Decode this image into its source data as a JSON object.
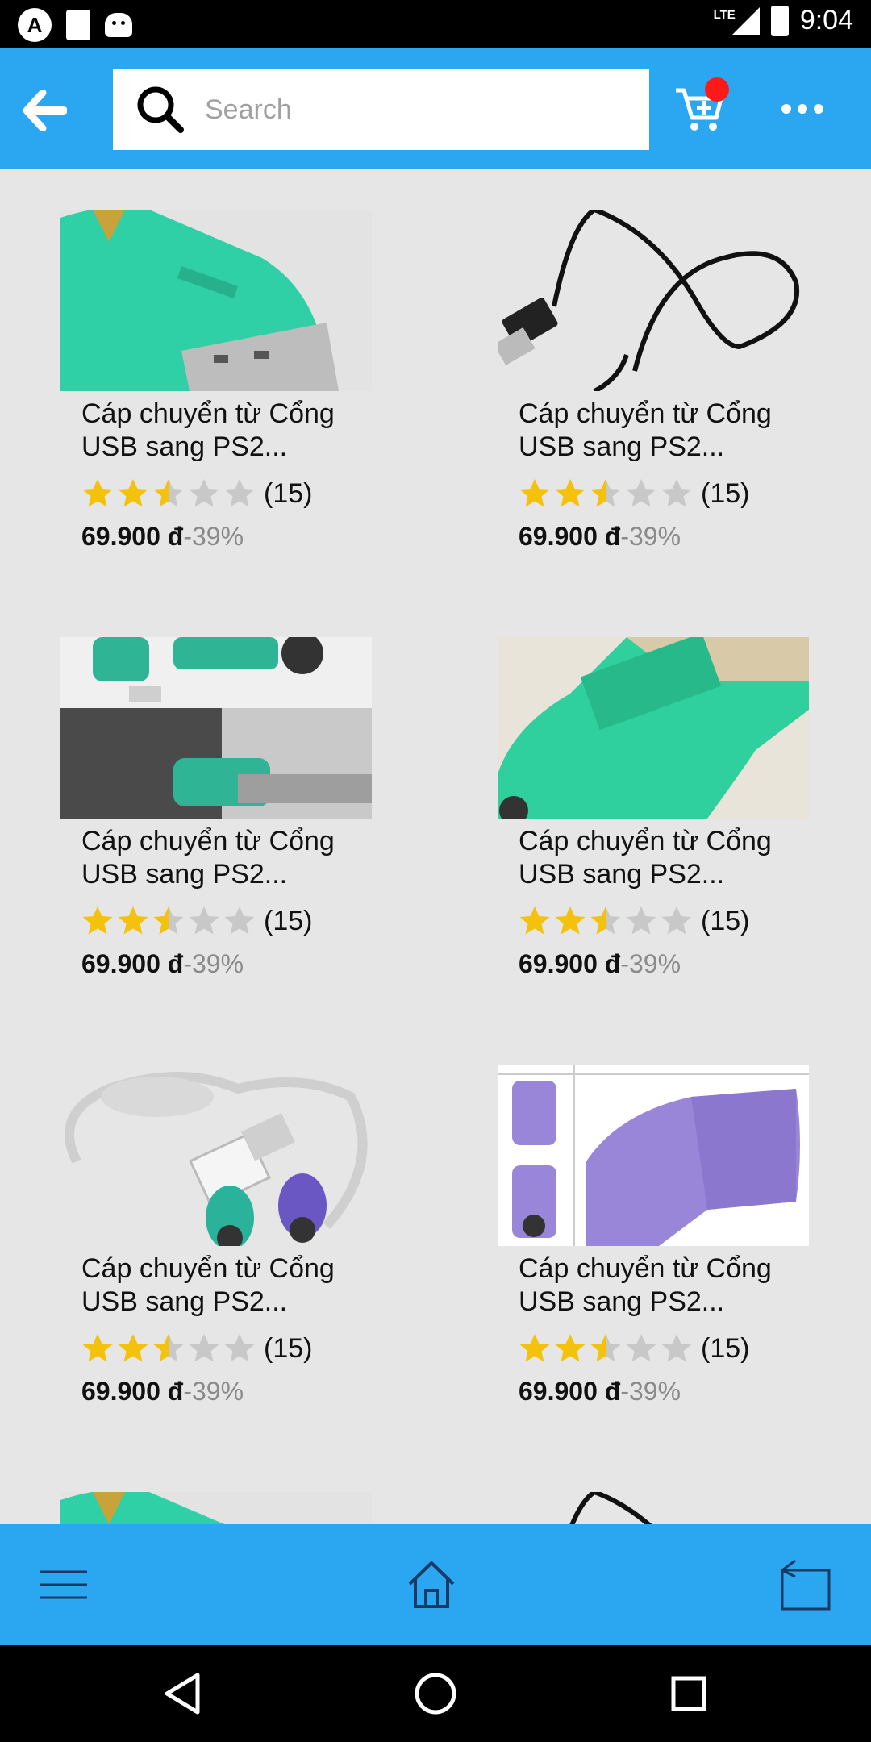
{
  "status_bar": {
    "network": "LTE",
    "time": "9:04",
    "left_icon_letter": "A"
  },
  "search": {
    "placeholder": "Search",
    "value": ""
  },
  "colors": {
    "app_bar": "#2aa7f0",
    "star_filled": "#f4c20d",
    "star_empty": "#c8c8c8",
    "cart_badge": "#ff1a1a"
  },
  "products": [
    {
      "title": "Cáp chuyển từ Cổng USB sang PS2...",
      "rating": 2.5,
      "reviews": "(15)",
      "price": "69.900 đ",
      "discount": "-39%",
      "image": "green-usb-ps2-adapter"
    },
    {
      "title": "Cáp chuyển từ Cổng USB sang PS2...",
      "rating": 2.5,
      "reviews": "(15)",
      "price": "69.900 đ",
      "discount": "-39%",
      "image": "black-usb-cable"
    },
    {
      "title": "Cáp chuyển từ Cổng USB sang PS2...",
      "rating": 2.5,
      "reviews": "(15)",
      "price": "69.900 đ",
      "discount": "-39%",
      "image": "adapters-plugged-in"
    },
    {
      "title": "Cáp chuyển từ Cổng USB sang PS2...",
      "rating": 2.5,
      "reviews": "(15)",
      "price": "69.900 đ",
      "discount": "-39%",
      "image": "green-adapter-closeup"
    },
    {
      "title": "Cáp chuyển từ Cổng USB sang PS2...",
      "rating": 2.5,
      "reviews": "(15)",
      "price": "69.900 đ",
      "discount": "-39%",
      "image": "usb-to-dual-ps2-splitter"
    },
    {
      "title": "Cáp chuyển từ Cổng USB sang PS2...",
      "rating": 2.5,
      "reviews": "(15)",
      "price": "69.900 đ",
      "discount": "-39%",
      "image": "purple-adapter"
    }
  ],
  "partial_products": [
    {
      "image": "green-usb-ps2-adapter"
    },
    {
      "image": "black-usb-cable"
    }
  ],
  "bottom_nav": {
    "items": [
      "menu-icon",
      "home-icon",
      "back-square-icon"
    ]
  },
  "system_nav": {
    "items": [
      "back-triangle-icon",
      "home-circle-icon",
      "recents-square-icon"
    ]
  }
}
